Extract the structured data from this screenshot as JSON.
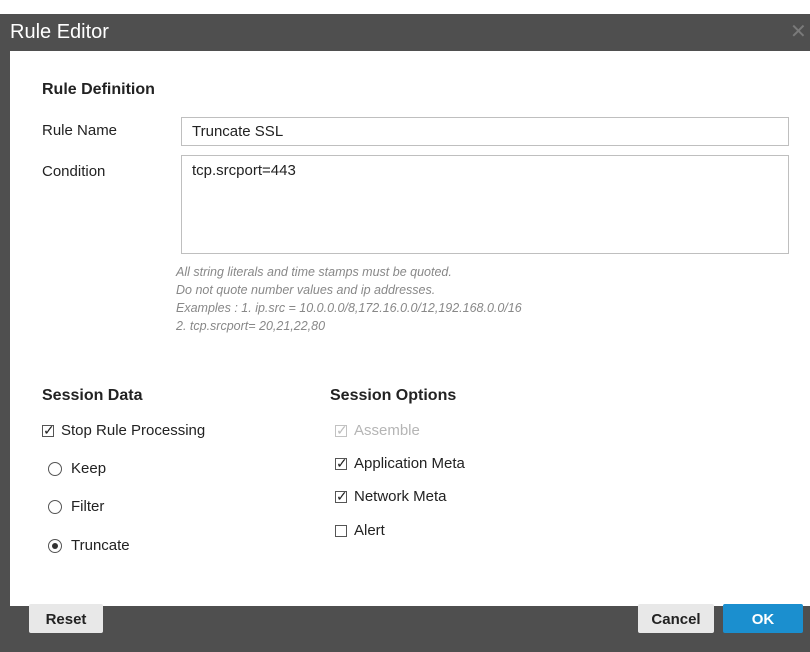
{
  "dialog": {
    "title": "Rule Editor",
    "close_glyph": "✕"
  },
  "rule_definition": {
    "heading": "Rule Definition",
    "rule_name_label": "Rule Name",
    "rule_name_value": "Truncate SSL",
    "condition_label": "Condition",
    "condition_value": "tcp.srcport=443",
    "hints": [
      "All string literals and time stamps must be quoted.",
      "Do not quote number values and ip addresses.",
      "Examples : 1. ip.src = 10.0.0.0/8,172.16.0.0/12,192.168.0.0/16",
      "2. tcp.srcport= 20,21,22,80"
    ]
  },
  "session_data": {
    "heading": "Session Data",
    "stop_rule_processing": {
      "label": "Stop Rule Processing",
      "checked": true
    },
    "options": [
      {
        "label": "Keep",
        "selected": false
      },
      {
        "label": "Filter",
        "selected": false
      },
      {
        "label": "Truncate",
        "selected": true
      }
    ]
  },
  "session_options": {
    "heading": "Session Options",
    "items": [
      {
        "label": "Assemble",
        "checked": true,
        "disabled": true
      },
      {
        "label": "Application Meta",
        "checked": true,
        "disabled": false
      },
      {
        "label": "Network Meta",
        "checked": true,
        "disabled": false
      },
      {
        "label": "Alert",
        "checked": false,
        "disabled": false
      }
    ]
  },
  "footer": {
    "reset_label": "Reset",
    "cancel_label": "Cancel",
    "ok_label": "OK"
  },
  "colors": {
    "chrome": "#4f4f4f",
    "primary_button": "#1b8fcf",
    "hint_text": "#888888"
  }
}
